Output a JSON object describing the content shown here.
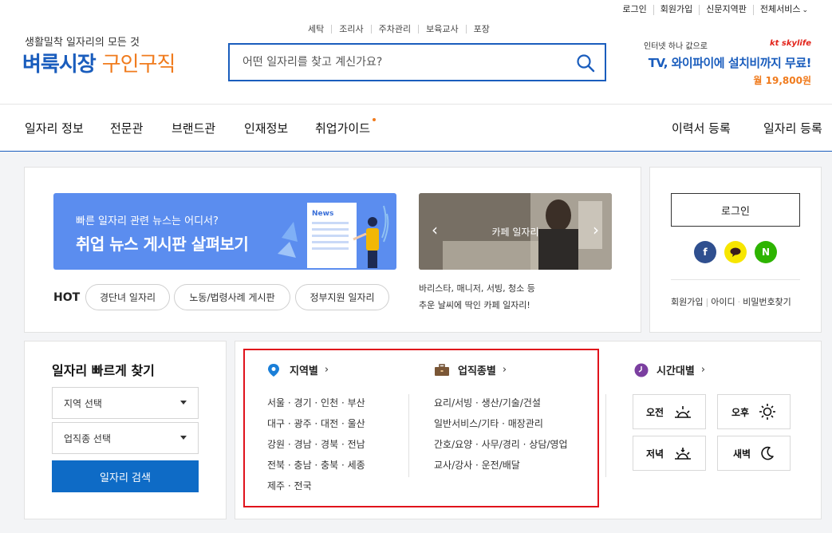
{
  "util_links": [
    "로그인",
    "회원가입",
    "신문지역판",
    "전체서비스"
  ],
  "logo": {
    "sub": "생활밀착 일자리의 모든 것",
    "main_blue": "벼룩시장",
    "main_orange": "구인구직"
  },
  "quicklinks": [
    "세탁",
    "조리사",
    "주차관리",
    "보육교사",
    "포장"
  ],
  "search": {
    "placeholder": "어떤 일자리를 찾고 계신가요?"
  },
  "ad": {
    "top": "인터넷 하나 값으로",
    "brand": "kt skylife",
    "main": "TV, 와이파이에 설치비까지 무료!",
    "price": "월 19,800원"
  },
  "nav": [
    "일자리 정보",
    "전문관",
    "브랜드관",
    "인재정보",
    "취업가이드"
  ],
  "nav_right": [
    "이력서 등록",
    "일자리 등록"
  ],
  "banner1": {
    "line1": "빠른 일자리 관련 뉴스는 어디서?",
    "line2": "취업 뉴스 게시판 살펴보기",
    "graphic_label": "News"
  },
  "banner2": {
    "caption": "카페 일자리"
  },
  "hot": {
    "label": "HOT",
    "items": [
      "경단녀 일자리",
      "노동/법령사례 게시판",
      "정부지원 일자리"
    ]
  },
  "cafe_desc": [
    "바리스타, 매니저, 서빙, 청소 등",
    "추운 날씨에 딱인 카페 일자리!"
  ],
  "login": {
    "button": "로그인",
    "links": [
      "회원가입",
      "아이디",
      "비밀번호찾기"
    ],
    "social": [
      "f",
      "N"
    ]
  },
  "quick_search": {
    "title": "일자리 빠르게 찾기",
    "region": "지역 선택",
    "job": "업직종 선택",
    "button": "일자리 검색"
  },
  "region": {
    "title": "지역별",
    "rows": [
      "서울 · 경기 · 인천 · 부산",
      "대구 · 광주 · 대전 · 울산",
      "강원 · 경남 · 경북 · 전남",
      "전북 · 충남 · 충북 · 세종",
      "제주 · 전국"
    ]
  },
  "jobtype": {
    "title": "업직종별",
    "rows": [
      "요리/서빙 · 생산/기술/건설",
      "일반서비스/기타 · 매장관리",
      "간호/요양 · 사무/경리 · 상담/영업",
      "교사/강사 · 운전/배달"
    ]
  },
  "time": {
    "title": "시간대별",
    "items": [
      "오전",
      "오후",
      "저녁",
      "새벽"
    ]
  },
  "colors": {
    "brand_blue": "#1a5dbd",
    "brand_orange": "#f07b1d",
    "highlight": "#e0121b"
  }
}
